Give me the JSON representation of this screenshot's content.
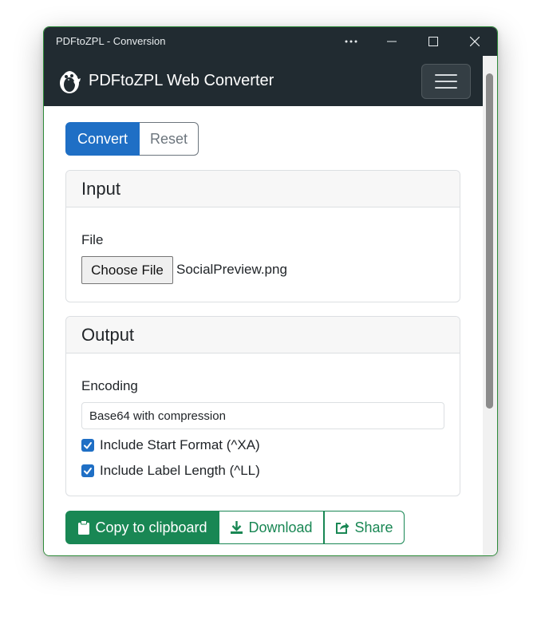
{
  "window": {
    "title": "PDFtoZPL - Conversion",
    "controls": {
      "more": "more-icon",
      "minimize": "minimize-icon",
      "maximize": "maximize-icon",
      "close": "close-icon"
    }
  },
  "navbar": {
    "brand": "PDFtoZPL Web Converter",
    "logo_icon": "tux-penguin-icon",
    "toggler_icon": "hamburger-menu-icon"
  },
  "mode_buttons": {
    "convert": "Convert",
    "reset": "Reset",
    "active": "convert"
  },
  "input_card": {
    "header": "Input",
    "file_label": "File",
    "choose_button": "Choose File",
    "file_name": "SocialPreview.png"
  },
  "output_card": {
    "header": "Output",
    "encoding_label": "Encoding",
    "encoding_value": "Base64 with compression",
    "checkboxes": [
      {
        "label": "Include Start Format (^XA)",
        "checked": true
      },
      {
        "label": "Include Label Length (^LL)",
        "checked": true
      }
    ]
  },
  "actions": {
    "copy": {
      "label": "Copy to clipboard",
      "icon": "clipboard-icon"
    },
    "download": {
      "label": "Download",
      "icon": "download-icon"
    },
    "share": {
      "label": "Share",
      "icon": "share-icon"
    }
  },
  "colors": {
    "titlebar": "#212b31",
    "primary": "#1f6fc5",
    "success": "#198754",
    "secondary": "#6c757d",
    "window_border": "#2e8b3a"
  }
}
